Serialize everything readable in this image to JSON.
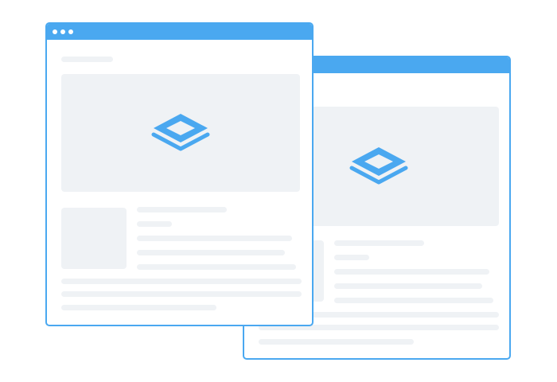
{
  "colors": {
    "accent": "#4aa8f0",
    "placeholder": "#eff2f5",
    "background": "#ffffff"
  },
  "front_window": {
    "titlebar_dots": [
      "dot",
      "dot",
      "dot"
    ],
    "hero_icon": "stack-layers-icon"
  },
  "back_window": {
    "hero_icon": "stack-layers-icon"
  }
}
